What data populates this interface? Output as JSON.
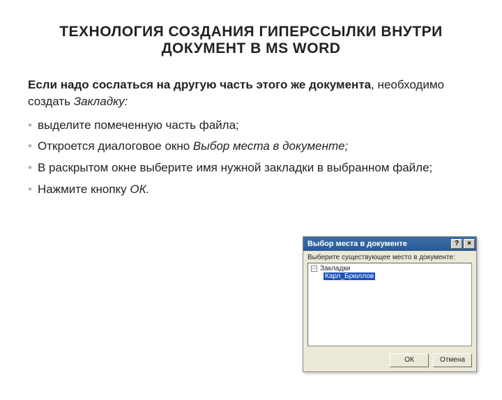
{
  "title": {
    "line1": "ТЕХНОЛОГИЯ СОЗДАНИЯ ГИПЕРССЫЛКИ ВНУТРИ",
    "line2_pre": "ДОКУМЕНТ В ",
    "line2_bold": "MS WORD"
  },
  "intro": {
    "strong": "Если надо сослаться на другую часть этого же документа",
    "rest1": ", необходимо создать ",
    "em": "Закладку:"
  },
  "bullets": [
    {
      "text": "выделите помеченную часть файла;",
      "em": ""
    },
    {
      "text": "Откроется диалоговое окно ",
      "em": "Выбор места в документе;"
    },
    {
      "text": "В раскрытом окне выберите имя нужной закладки в выбранном файле;",
      "em": ""
    },
    {
      "text": "Нажмите кнопку ",
      "em": "ОК."
    }
  ],
  "dialog": {
    "title": "Выбор места в документе",
    "help_btn": "?",
    "close_btn": "×",
    "instruction": "Выберите существующее место в документе:",
    "tree": {
      "toggle": "−",
      "root": "Закладки",
      "child": "Карл_Брюллов"
    },
    "ok": "ОК",
    "cancel": "Отмена"
  }
}
